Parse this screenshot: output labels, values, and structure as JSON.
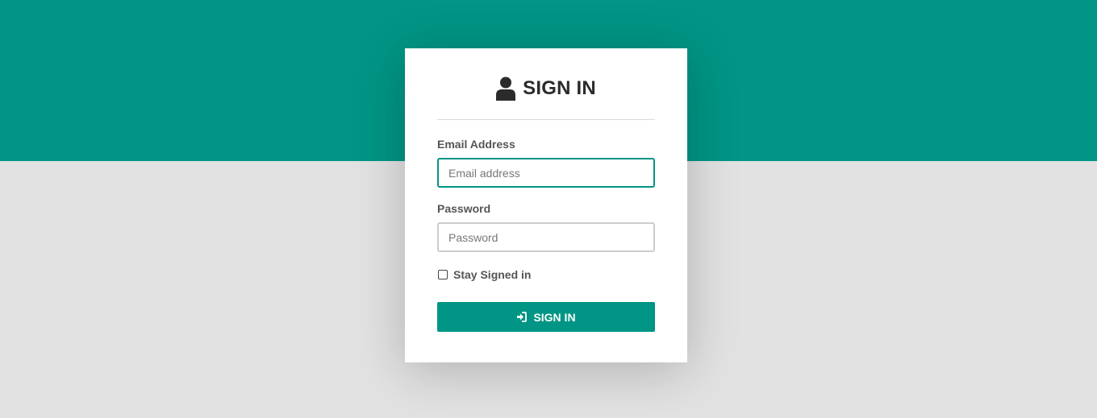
{
  "colors": {
    "accent": "#009585",
    "background": "#e2e2e2",
    "card": "#ffffff"
  },
  "header": {
    "icon": "user-icon",
    "title": "SIGN IN"
  },
  "form": {
    "email": {
      "label": "Email Address",
      "placeholder": "Email address",
      "value": ""
    },
    "password": {
      "label": "Password",
      "placeholder": "Password",
      "value": ""
    },
    "stay_signed_in": {
      "label": "Stay Signed in",
      "checked": false
    },
    "submit": {
      "icon": "sign-in-icon",
      "label": "SIGN IN"
    }
  }
}
